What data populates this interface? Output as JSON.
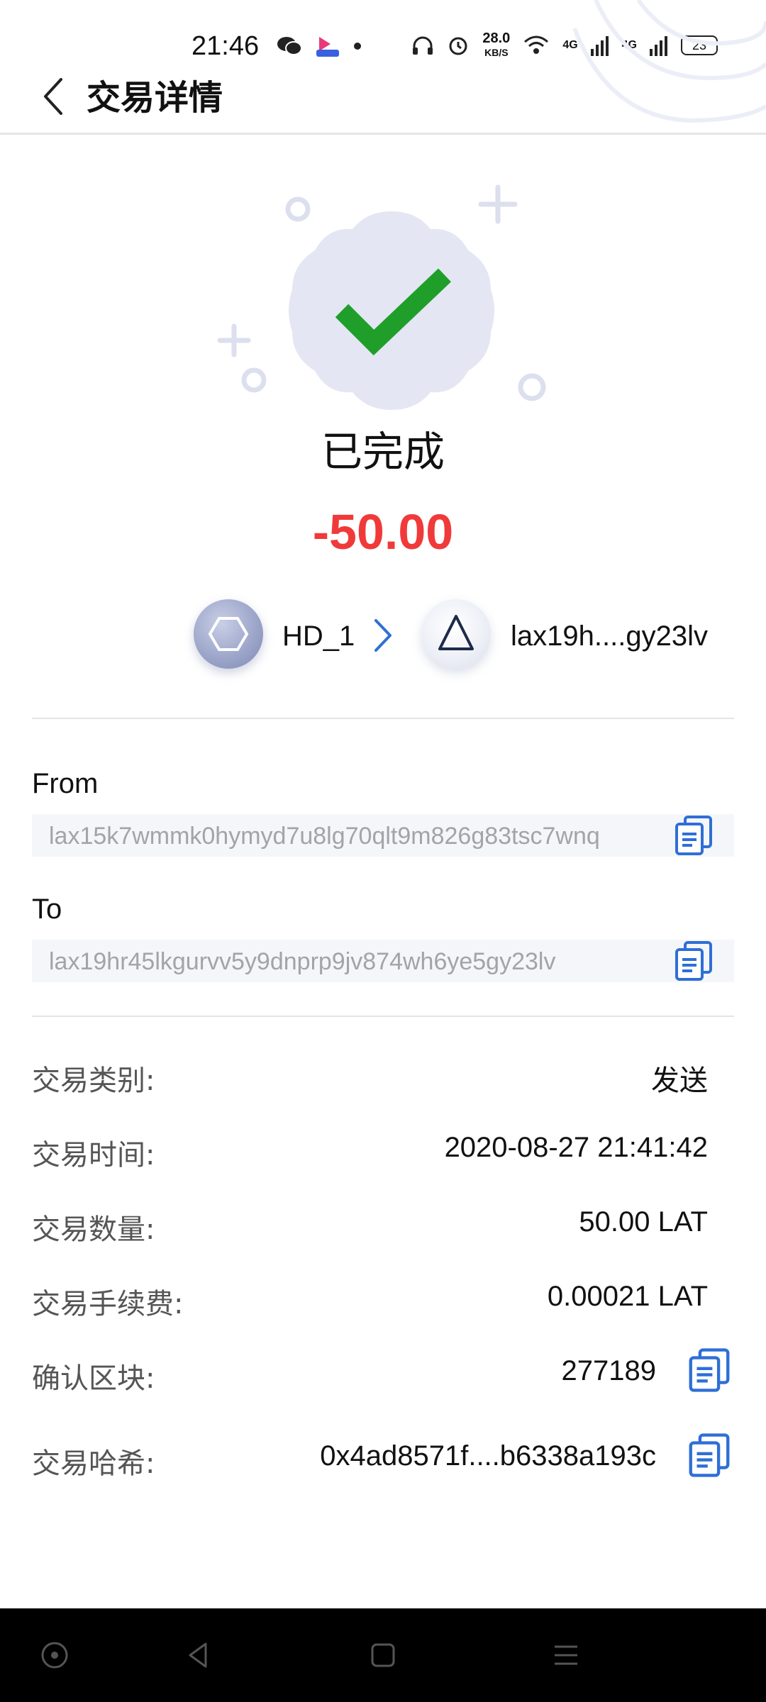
{
  "status_bar": {
    "time": "21:46",
    "net_speed_value": "28.0",
    "net_speed_unit": "KB/S",
    "signal1": "4G",
    "signal2": "4G",
    "battery": "23"
  },
  "header": {
    "title": "交易详情"
  },
  "transaction": {
    "status": "已完成",
    "amount": "-50.00",
    "from_name": "HD_1",
    "to_short": "lax19h....gy23lv"
  },
  "addresses": {
    "from_label": "From",
    "from_value": "lax15k7wmmk0hymyd7u8lg70qlt9m826g83tsc7wnq",
    "to_label": "To",
    "to_value": "lax19hr45lkgurvv5y9dnprp9jv874wh6ye5gy23lv"
  },
  "details": [
    {
      "label": "交易类别:",
      "value": "发送"
    },
    {
      "label": "交易时间:",
      "value": "2020-08-27 21:41:42"
    },
    {
      "label": "交易数量:",
      "value": "50.00 LAT"
    },
    {
      "label": "交易手续费:",
      "value": "0.00021 LAT"
    },
    {
      "label": "确认区块:",
      "value": "277189"
    },
    {
      "label": "交易哈希:",
      "value": "0x4ad8571f....b6338a193c"
    }
  ],
  "colors": {
    "accent_blue": "#2f6fd6",
    "amount_red": "#f03a3a",
    "success_green": "#1f9e2a",
    "badge_bg": "#e4e6f3"
  },
  "icons": {
    "back": "chevron-left-icon",
    "copy": "copy-icon",
    "check": "check-icon",
    "arrow": "chevron-right-icon"
  }
}
